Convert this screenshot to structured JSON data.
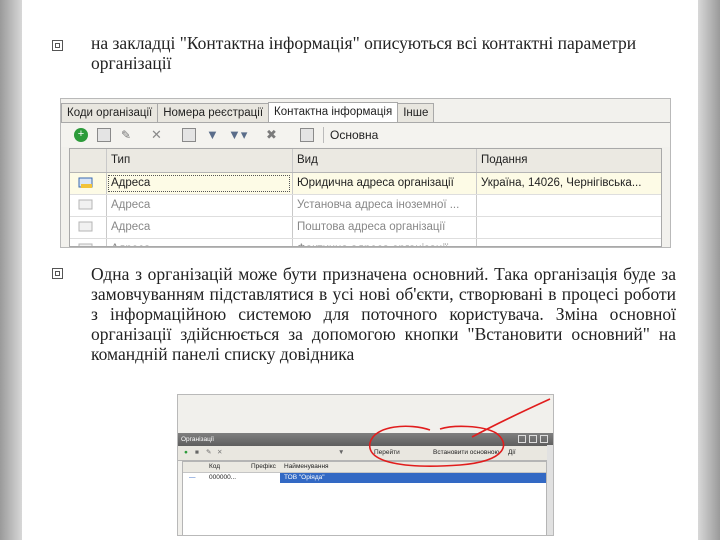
{
  "paragraphs": [
    "на закладці \"Контактна інформація\" описуються всі контактні параметри організації",
    "Одна з організацій може бути призначена основний. Така організація буде за замовчуванням підставлятися в усі нові об'єкти, створювані в процесі роботи з інформаційною системою для поточного користувача. Зміна основної організації здійснюється за допомогою кнопки \"Встановити основний\" на командній панелі списку довідника"
  ],
  "screenshot1": {
    "tabs": [
      {
        "label": "Коди організації",
        "active": false
      },
      {
        "label": "Номера реєстрації",
        "active": false
      },
      {
        "label": "Контактна інформація",
        "active": true
      },
      {
        "label": "Інше",
        "active": false
      }
    ],
    "toolbar": {
      "main_label": "Основна"
    },
    "columns": [
      "Тип",
      "Вид",
      "Подання"
    ],
    "rows": [
      {
        "type": "Адреса",
        "kind": "Юридична адреса організації",
        "view": "Україна, 14026, Чернігівська...",
        "selected": true
      },
      {
        "type": "Адреса",
        "kind": "Установча адреса іноземної ...",
        "view": "",
        "selected": false
      },
      {
        "type": "Адреса",
        "kind": "Поштова адреса організації",
        "view": "",
        "selected": false
      },
      {
        "type": "Адреса",
        "kind": "Фактична адреса організації",
        "view": "",
        "selected": false
      }
    ]
  },
  "screenshot2": {
    "window_title": "Організації",
    "toolbar_items": [
      "Перейти",
      "Встановити основною",
      "Дії"
    ],
    "columns": [
      "Код",
      "Префікс",
      "Найменування"
    ],
    "row": {
      "code": "000000...",
      "prefix": "",
      "name": "ТОВ \"Оріяда\""
    }
  },
  "colors": {
    "selected_row": "#fdfbe6",
    "selection_blue": "#3369c4",
    "annotation_red": "#e11d1d"
  }
}
